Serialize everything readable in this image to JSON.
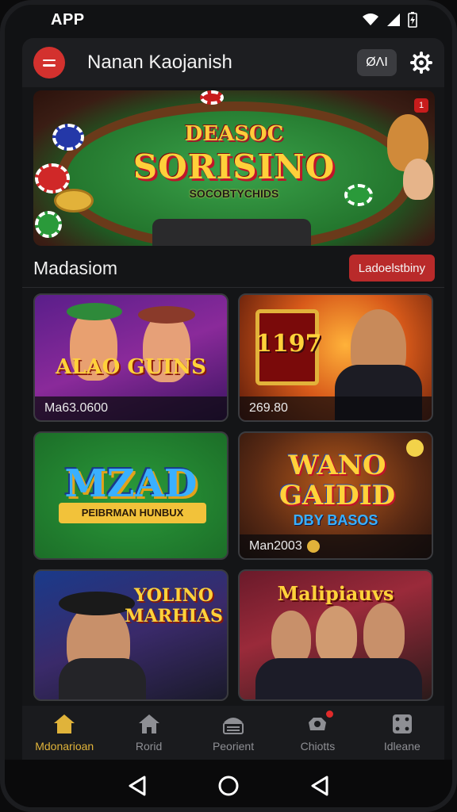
{
  "status_bar": {
    "app_label": "APP"
  },
  "app_bar": {
    "title": "Nanan Kaojanish",
    "lang_label": "ØΛΙ"
  },
  "hero": {
    "line1": "DEASOC",
    "line2": "SORISINO",
    "line3": "SOCOBTYCHIDS",
    "badge": "1"
  },
  "section": {
    "title": "Madasiom",
    "button_label": "Ladoelstbiny"
  },
  "cards": [
    {
      "title": "ALAO GUINS",
      "caption": "Ma63.0600"
    },
    {
      "title": "1197",
      "caption": "269.80"
    },
    {
      "title": "MZAD",
      "subtitle": "PEIBRMAN HUNBUX"
    },
    {
      "title": "WANO GAIDID",
      "subtitle": "DBY BASOS",
      "caption": "Man2003"
    },
    {
      "title": "YOLINO MARHIAS"
    },
    {
      "title": "Malipiauvs"
    }
  ],
  "bottom_nav": [
    {
      "label": "Mdonarioan",
      "icon": "home-icon",
      "active": true
    },
    {
      "label": "Rorid",
      "icon": "house-icon"
    },
    {
      "label": "Peorient",
      "icon": "casino-cashier-icon"
    },
    {
      "label": "Chiotts",
      "icon": "chips-icon",
      "has_badge": true
    },
    {
      "label": "Idleane",
      "icon": "dice-icon"
    }
  ],
  "colors": {
    "accent": "#d3312e",
    "active_nav": "#e0b33a",
    "background": "#141517"
  }
}
